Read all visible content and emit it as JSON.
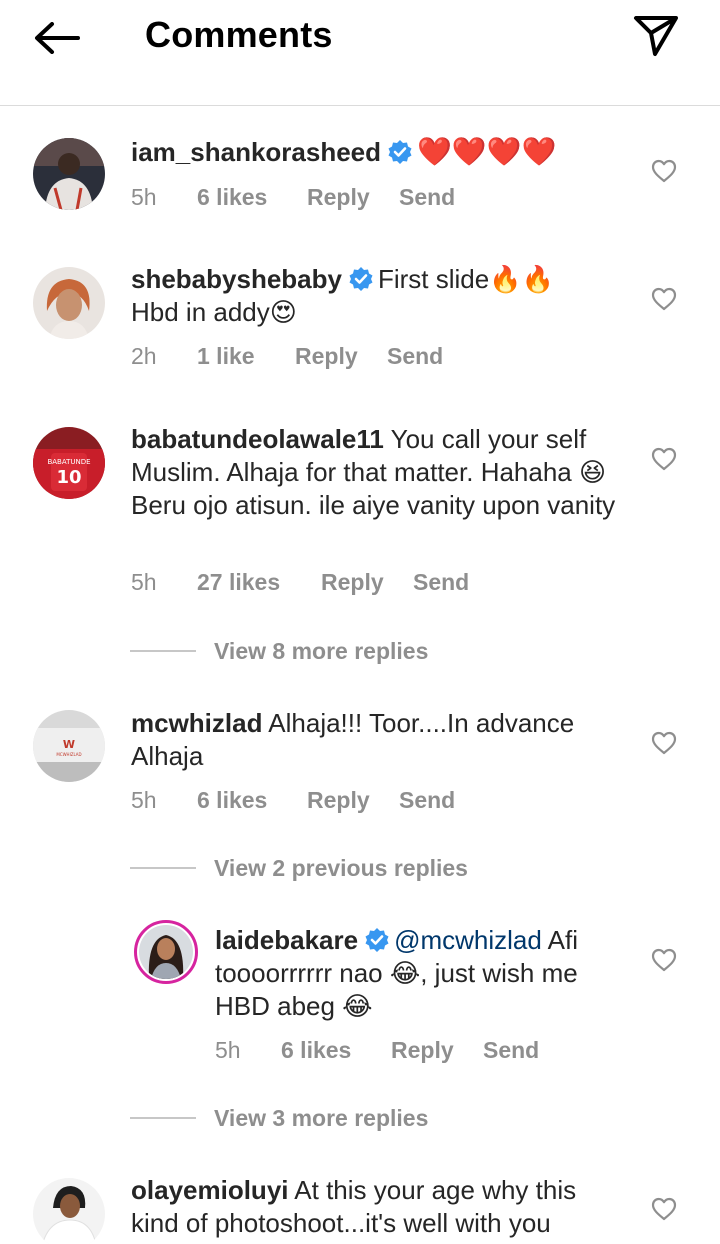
{
  "header": {
    "title": "Comments",
    "back_icon": "arrow-left-icon",
    "share_icon": "paper-plane-icon"
  },
  "colors": {
    "verified_blue": "#3897f0",
    "meta_gray": "#8e8e8e",
    "divider": "#dbdbdb",
    "mention": "#00376b"
  },
  "comments": [
    {
      "username": "iam_shankorasheed",
      "verified": true,
      "text": "❤️❤️❤️❤️",
      "time": "5h",
      "likes": "6 likes",
      "reply": "Reply",
      "send": "Send"
    },
    {
      "username": "shebabyshebaby",
      "verified": true,
      "text_line1": "First slide🔥🔥",
      "text_line2": "Hbd in addy😍",
      "time": "2h",
      "likes": "1 like",
      "reply": "Reply",
      "send": "Send"
    },
    {
      "username": "babatundeolawale11",
      "verified": false,
      "text": "You call your self Muslim. Alhaja for that matter. Hahaha 😆 Beru ojo atisun. ile aiye vanity upon vanity",
      "time": "5h",
      "likes": "27 likes",
      "reply": "Reply",
      "send": "Send",
      "view_more": "View 8 more replies"
    },
    {
      "username": "mcwhizlad",
      "verified": false,
      "text": "Alhaja!!! Toor....In advance Alhaja",
      "time": "5h",
      "likes": "6 likes",
      "reply": "Reply",
      "send": "Send",
      "view_previous": "View 2 previous replies",
      "reply_item": {
        "username": "laidebakare",
        "verified": true,
        "mention": "@mcwhizlad",
        "text": "Afi toooorrrrrr nao 😂, just wish me HBD abeg 😂",
        "time": "5h",
        "likes": "6 likes",
        "reply": "Reply",
        "send": "Send"
      },
      "view_more": "View 3 more replies"
    },
    {
      "username": "olayemioluyi",
      "verified": false,
      "text": "At this your age why this kind of photoshoot...it's well with you"
    }
  ]
}
